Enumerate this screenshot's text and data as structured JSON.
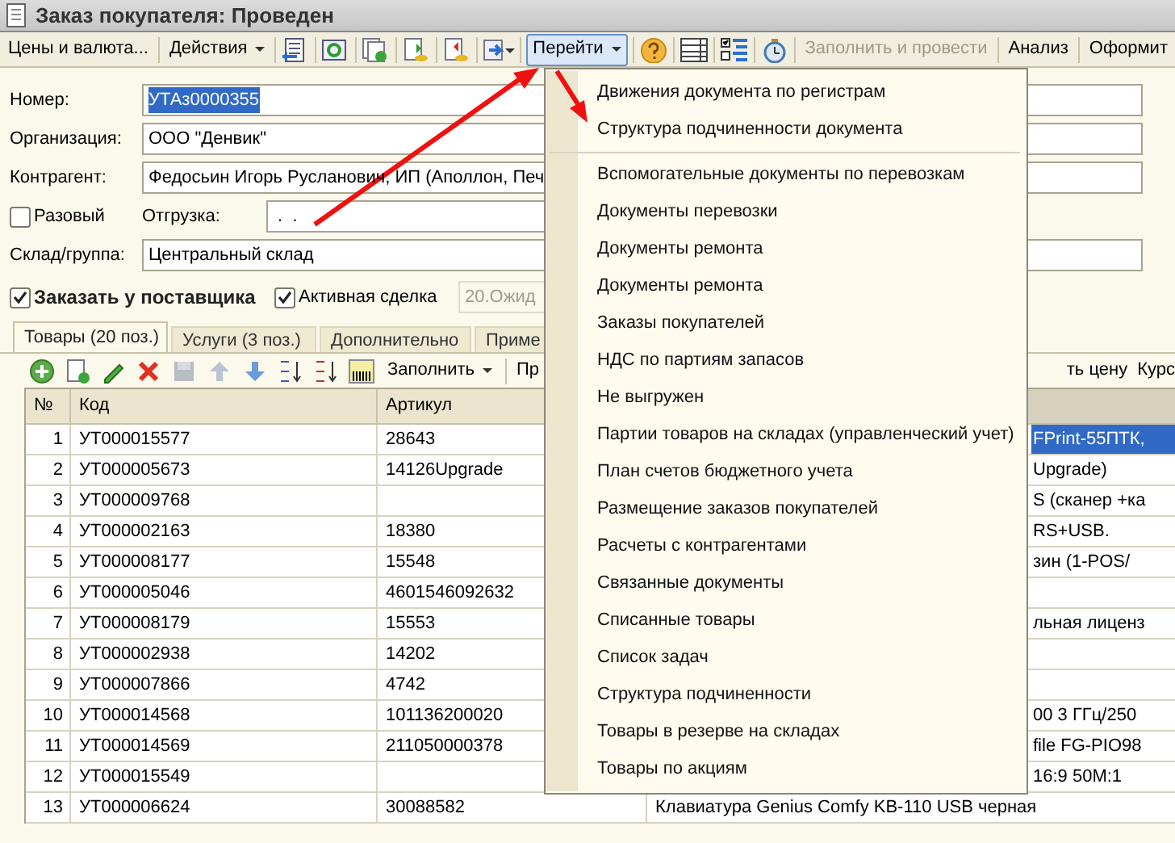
{
  "window": {
    "title": "Заказ покупателя: Проведен"
  },
  "toolbar": {
    "items": [
      {
        "kind": "text",
        "label": "Цены и валюта...",
        "disabled": false
      },
      {
        "kind": "menu",
        "label": "Действия",
        "disabled": false,
        "pressed": false
      },
      {
        "kind": "icon"
      },
      {
        "kind": "icon"
      },
      {
        "kind": "icon"
      },
      {
        "kind": "icon"
      },
      {
        "kind": "icon"
      },
      {
        "kind": "icon"
      },
      {
        "kind": "menu",
        "label": "Перейти",
        "disabled": false,
        "pressed": true
      },
      {
        "kind": "icon"
      },
      {
        "kind": "icon"
      },
      {
        "kind": "icon"
      },
      {
        "kind": "icon"
      },
      {
        "kind": "text",
        "label": "Заполнить и провести",
        "disabled": true
      },
      {
        "kind": "text",
        "label": "Анализ",
        "disabled": false
      },
      {
        "kind": "text",
        "label": "Оформит",
        "disabled": false
      }
    ]
  },
  "form": {
    "number": {
      "label": "Номер:",
      "value": "УТАз0000355"
    },
    "organization": {
      "label": "Организация:",
      "value": "ООО \"Денвик\""
    },
    "counterparty": {
      "label": "Контрагент:",
      "value": "Федосьин Игорь Русланович, ИП (Аполлон, Печ"
    },
    "one_time": {
      "label": "Разовый",
      "checked": false
    },
    "shipment": {
      "label": "Отгрузка:",
      "value": " .  . "
    },
    "warehouse": {
      "label": "Склад/группа:",
      "value": "Центральный склад"
    },
    "order_from_supplier": {
      "label": "Заказать у поставщика",
      "checked": true
    },
    "active_deal": {
      "label": "Активная сделка",
      "checked": true
    },
    "status": {
      "value": "20.Ожид"
    }
  },
  "tabs": [
    {
      "label": "Товары (20 поз.)",
      "selected": true
    },
    {
      "label": "Услуги (3 поз.)",
      "selected": false
    },
    {
      "label": "Дополнительно",
      "selected": false
    },
    {
      "label": "Приме",
      "selected": false
    }
  ],
  "table_toolbar": {
    "fill_label": "Заполнить",
    "cut_label": "Пр",
    "right_texts": [
      "ть цену",
      "Курс"
    ]
  },
  "table": {
    "columns": [
      "№",
      "Код",
      "Артикул"
    ],
    "rows": [
      {
        "n": "1",
        "code": "УТ000015577",
        "article": "28643",
        "column_4": "FPrint-55ПТК,",
        "selected": true
      },
      {
        "n": "2",
        "code": "УТ000005673",
        "article": "14126Upgrade",
        "column_4": "Upgrade)",
        "selected": false
      },
      {
        "n": "3",
        "code": "УТ000009768",
        "article": "",
        "column_4": "S (сканер +ка",
        "selected": false
      },
      {
        "n": "4",
        "code": "УТ000002163",
        "article": "18380",
        "column_4": "RS+USB.",
        "selected": false
      },
      {
        "n": "5",
        "code": "УТ000008177",
        "article": "15548",
        "column_4": "зин (1-POS/",
        "selected": false
      },
      {
        "n": "6",
        "code": "УТ000005046",
        "article": "4601546092632",
        "column_4": "",
        "selected": false
      },
      {
        "n": "7",
        "code": "УТ000008179",
        "article": "15553",
        "column_4": "льная лиценз",
        "selected": false
      },
      {
        "n": "8",
        "code": "УТ000002938",
        "article": "14202",
        "column_4": "",
        "selected": false
      },
      {
        "n": "9",
        "code": "УТ000007866",
        "article": "4742",
        "column_4": "",
        "selected": false
      },
      {
        "n": "10",
        "code": "УТ000014568",
        "article": "101136200020",
        "column_4": "00 3 ГГц/250",
        "selected": false
      },
      {
        "n": "11",
        "code": "УТ000014569",
        "article": "211050000378",
        "column_4": "file FG-PIO98",
        "selected": false
      },
      {
        "n": "12",
        "code": "УТ000015549",
        "article": "",
        "column_4": "16:9 50M:1",
        "selected": false
      },
      {
        "n": "13",
        "code": "УТ000006624",
        "article": "30088582",
        "column_4": "Клавиатура Genius Comfy KB-110 USB черная",
        "selected": false
      }
    ]
  },
  "dropdown_menu": {
    "items": [
      {
        "kind": "item",
        "label": "Движения документа по регистрам"
      },
      {
        "kind": "item",
        "label": "Структура подчиненности документа"
      },
      {
        "kind": "separator"
      },
      {
        "kind": "item",
        "label": "Вспомогательные документы по перевозкам"
      },
      {
        "kind": "item",
        "label": "Документы перевозки"
      },
      {
        "kind": "item",
        "label": "Документы ремонта"
      },
      {
        "kind": "item",
        "label": "Документы ремонта"
      },
      {
        "kind": "item",
        "label": "Заказы покупателей"
      },
      {
        "kind": "item",
        "label": "НДС по партиям запасов"
      },
      {
        "kind": "item",
        "label": "Не выгружен"
      },
      {
        "kind": "item",
        "label": "Партии товаров на складах (управленческий учет)"
      },
      {
        "kind": "item",
        "label": "План счетов бюджетного учета"
      },
      {
        "kind": "item",
        "label": "Размещение заказов покупателей"
      },
      {
        "kind": "item",
        "label": "Расчеты с контрагентами"
      },
      {
        "kind": "item",
        "label": "Связанные документы"
      },
      {
        "kind": "item",
        "label": "Списанные товары"
      },
      {
        "kind": "item",
        "label": "Список задач"
      },
      {
        "kind": "item",
        "label": "Структура подчиненности"
      },
      {
        "kind": "item",
        "label": "Товары в резерве на складах"
      },
      {
        "kind": "item",
        "label": "Товары по акциям"
      }
    ]
  }
}
